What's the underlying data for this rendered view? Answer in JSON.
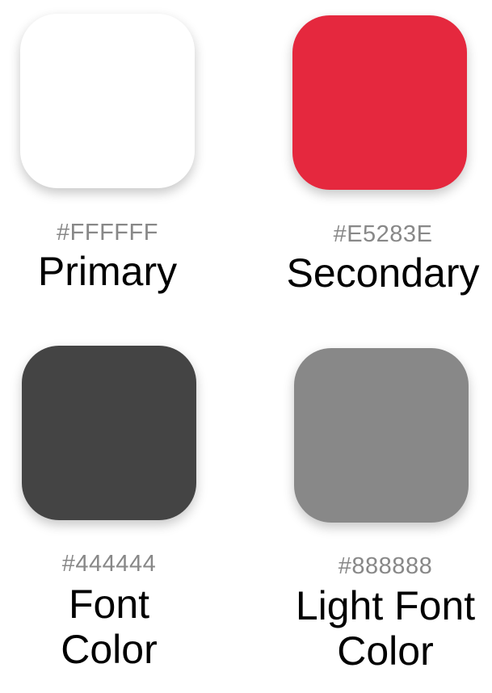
{
  "swatches": [
    {
      "hex": "#FFFFFF",
      "name": "Primary",
      "color": "#FFFFFF"
    },
    {
      "hex": "#E5283E",
      "name": "Secondary",
      "color": "#E5283E"
    },
    {
      "hex": "#444444",
      "name_line1": "Font",
      "name_line2": "Color",
      "color": "#444444"
    },
    {
      "hex": "#888888",
      "name_line1": "Light Font",
      "name_line2": "Color",
      "color": "#888888"
    }
  ]
}
